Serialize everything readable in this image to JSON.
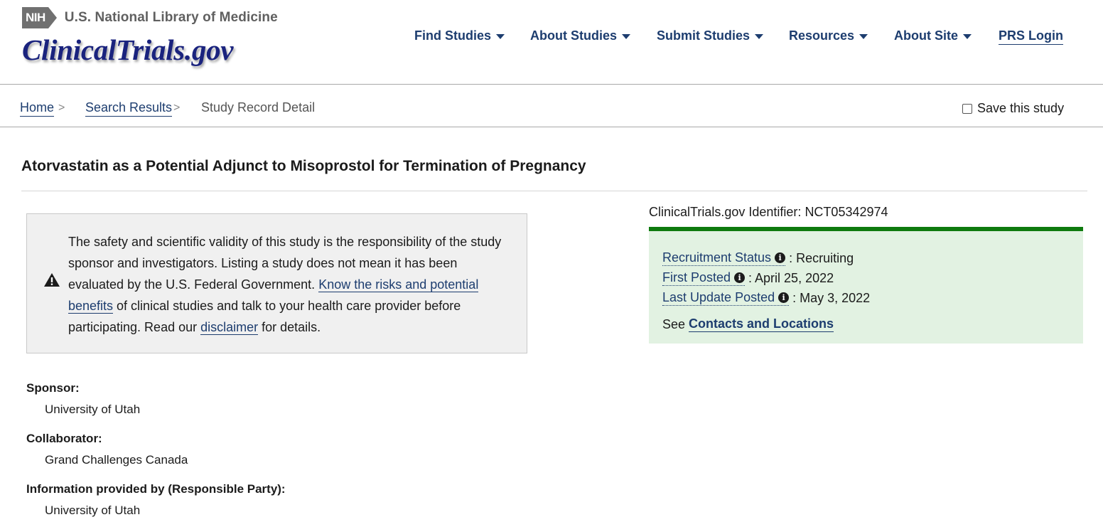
{
  "header": {
    "nih_badge": "NIH",
    "nih_text": "U.S. National Library of Medicine",
    "logo_text": "ClinicalTrials.gov"
  },
  "nav": {
    "find_studies": "Find Studies",
    "about_studies": "About Studies",
    "submit_studies": "Submit Studies",
    "resources": "Resources",
    "about_site": "About Site",
    "prs_login": "PRS Login"
  },
  "breadcrumb": {
    "home": "Home",
    "search_results": "Search Results",
    "current": "Study Record Detail",
    "separator": ">"
  },
  "save_study_label": "Save this study",
  "study": {
    "title": "Atorvastatin as a Potential Adjunct to Misoprostol for Termination of Pregnancy"
  },
  "disclaimer": {
    "text_1": "The safety and scientific validity of this study is the responsibility of the study sponsor and investigators. Listing a study does not mean it has been evaluated by the U.S. Federal Government. ",
    "link_risks": "Know the risks and potential benefits",
    "text_2": " of clinical studies and talk to your health care provider before participating. Read our ",
    "link_disclaimer": "disclaimer",
    "text_3": " for details."
  },
  "identifier": {
    "label": "ClinicalTrials.gov Identifier:",
    "value": "NCT05342974"
  },
  "status": {
    "recruitment_label": "Recruitment Status",
    "recruitment_value": ": Recruiting",
    "first_posted_label": "First Posted",
    "first_posted_value": ": April 25, 2022",
    "last_update_label": "Last Update Posted",
    "last_update_value": ": May 3, 2022",
    "see_text": "See",
    "contacts_link": "Contacts and Locations",
    "info_glyph": "i"
  },
  "sponsor_info": {
    "sponsor_label": "Sponsor:",
    "sponsor_value": "University of Utah",
    "collaborator_label": "Collaborator:",
    "collaborator_value": "Grand Challenges Canada",
    "responsible_label": "Information provided by (Responsible Party):",
    "responsible_value": "University of Utah"
  },
  "colors": {
    "link": "#1d3d6f",
    "status_bg": "#e2f2e2",
    "status_border": "#0e7a0e",
    "disclaimer_bg": "#f0f0f0"
  },
  "icons": [
    "warning-icon",
    "info-icon",
    "caret-down-icon",
    "checkbox-icon"
  ]
}
